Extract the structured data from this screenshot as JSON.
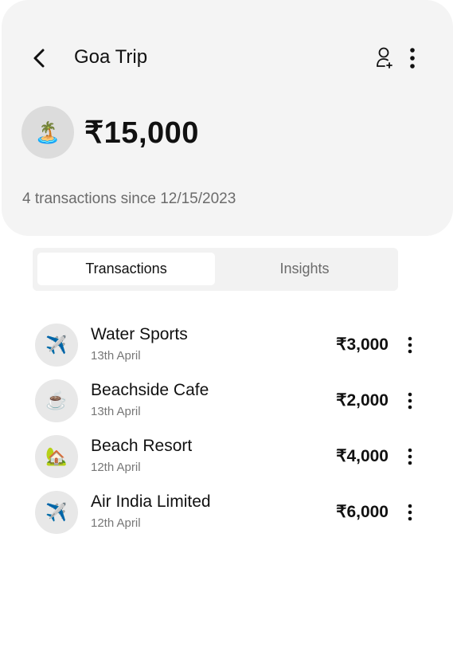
{
  "header": {
    "title": "Goa Trip",
    "trip_emoji": "🏝️",
    "total": "₹15,000",
    "subtitle": "4 transactions since 12/15/2023",
    "icons": [
      "chevron-left-icon",
      "add-user-icon",
      "more-vertical-icon"
    ]
  },
  "tabs": [
    {
      "label": "Transactions",
      "active": true
    },
    {
      "label": "Insights",
      "active": false
    }
  ],
  "transactions": [
    {
      "name": "Water Sports",
      "date": "13th April",
      "amount": "₹3,000",
      "emoji": "✈️"
    },
    {
      "name": "Beachside Cafe",
      "date": "13th April",
      "amount": "₹2,000",
      "emoji": "☕"
    },
    {
      "name": "Beach Resort",
      "date": "12th April",
      "amount": "₹4,000",
      "emoji": "🏡"
    },
    {
      "name": "Air India Limited",
      "date": "12th April",
      "amount": "₹6,000",
      "emoji": "✈️"
    }
  ],
  "colors": {
    "card_bg": "#f4f4f4",
    "text_primary": "#111111",
    "text_secondary": "#6b6b6b",
    "icon_circle": "#e8e8e8"
  }
}
